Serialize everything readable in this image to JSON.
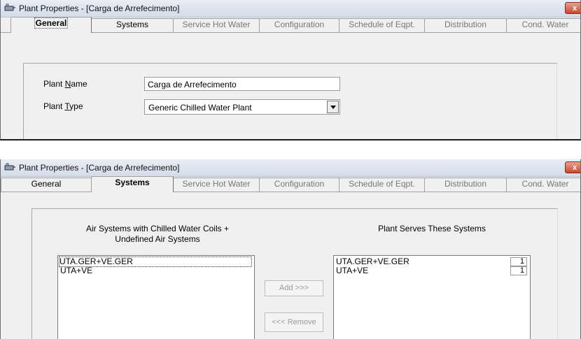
{
  "window_title": "Plant Properties - [Carga de Arrefecimento]",
  "close_glyph": "x",
  "tabs": [
    "General",
    "Systems",
    "Service Hot Water",
    "Configuration",
    "Schedule of Eqpt.",
    "Distribution",
    "Cond. Water"
  ],
  "general": {
    "plant_name_label": {
      "pre": "Plant ",
      "u": "N",
      "post": "ame"
    },
    "plant_type_label": {
      "pre": "Plant ",
      "u": "T",
      "post": "ype"
    },
    "plant_name_value": "Carga de Arrefecimento",
    "plant_type_value": "Generic Chilled Water Plant"
  },
  "systems": {
    "left_header_line1": "Air Systems with Chilled Water Coils +",
    "left_header_line2": "Undefined Air Systems",
    "right_header": "Plant Serves These Systems",
    "available": [
      "UTA.GER+VE.GER",
      "UTA+VE"
    ],
    "served": [
      {
        "name": "UTA.GER+VE.GER",
        "count": "1"
      },
      {
        "name": "UTA+VE",
        "count": "1"
      }
    ],
    "add_label": "Add >>>",
    "remove_label": "<<< Remove"
  }
}
